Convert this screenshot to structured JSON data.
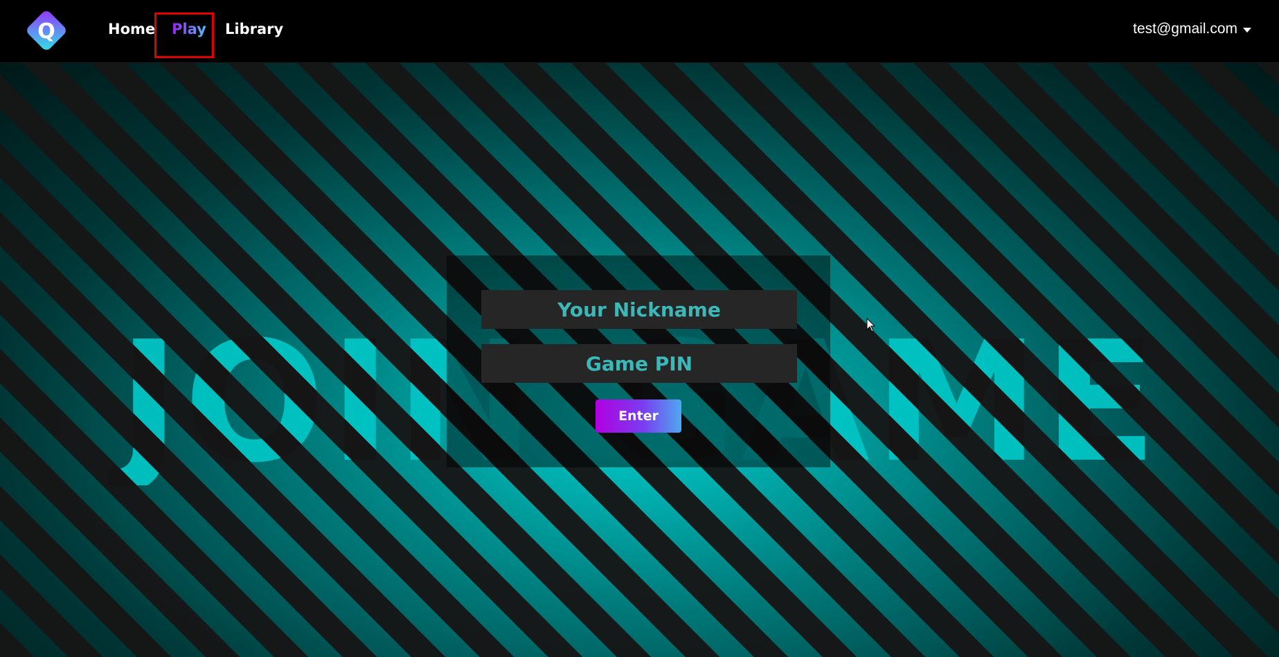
{
  "navbar": {
    "logo_letter": "Q",
    "links": [
      {
        "label": "Home"
      },
      {
        "label": "Play"
      },
      {
        "label": "Library"
      }
    ],
    "user_email": "test@gmail.com"
  },
  "background": {
    "title": "JOIN GAME"
  },
  "join_form": {
    "nickname_placeholder": "Your Nickname",
    "pin_placeholder": "Game PIN",
    "enter_label": "Enter"
  },
  "colors": {
    "accent_purple": "#a020f0",
    "accent_blue": "#4fc3f7",
    "teal": "#00c4c4",
    "highlight_red": "#e00000"
  }
}
